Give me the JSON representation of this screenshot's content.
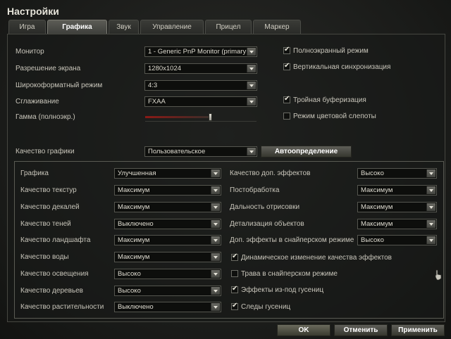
{
  "window": {
    "title": "Настройки"
  },
  "tabs": [
    "Игра",
    "Графика",
    "Звук",
    "Управление",
    "Прицел",
    "Маркер"
  ],
  "active_tab": "Графика",
  "display": {
    "monitor_label": "Монитор",
    "monitor_value": "1 - Generic PnP Monitor (primary",
    "resolution_label": "Разрешение экрана",
    "resolution_value": "1280x1024",
    "widescreen_label": "Широкоформатный режим",
    "widescreen_value": "4:3",
    "aa_label": "Сглаживание",
    "aa_value": "FXAA",
    "gamma_label": "Гамма (полноэкр.)",
    "gamma_level": 0.58
  },
  "checks_right": [
    {
      "label": "Полноэкранный режим",
      "checked": true
    },
    {
      "label": "Вертикальная синхронизация",
      "checked": true
    },
    {
      "label": "Тройная буферизация",
      "checked": true
    },
    {
      "label": "Режим цветовой слепоты",
      "checked": false
    }
  ],
  "quality": {
    "label": "Качество графики",
    "value": "Пользовательское",
    "auto_button": "Автоопределение"
  },
  "left_settings": [
    {
      "label": "Графика",
      "value": "Улучшенная"
    },
    {
      "label": "Качество текстур",
      "value": "Максимум"
    },
    {
      "label": "Качество декалей",
      "value": "Максимум"
    },
    {
      "label": "Качество теней",
      "value": "Выключено"
    },
    {
      "label": "Качество ландшафта",
      "value": "Максимум"
    },
    {
      "label": "Качество воды",
      "value": "Максимум"
    },
    {
      "label": "Качество освещения",
      "value": "Высоко"
    },
    {
      "label": "Качество деревьев",
      "value": "Высоко"
    },
    {
      "label": "Качество растительности",
      "value": "Выключено"
    }
  ],
  "right_settings": [
    {
      "label": "Качество доп. эффектов",
      "value": "Высоко"
    },
    {
      "label": "Постобработка",
      "value": "Максимум"
    },
    {
      "label": "Дальность отрисовки",
      "value": "Максимум"
    },
    {
      "label": "Детализация объектов",
      "value": "Максимум"
    },
    {
      "label": "Доп. эффекты в снайперском режиме",
      "value": "Высоко"
    }
  ],
  "right_checks": [
    {
      "label": "Динамическое изменение качества эффектов",
      "checked": true
    },
    {
      "label": "Трава в снайперском режиме",
      "checked": false
    },
    {
      "label": "Эффекты из-под гусениц",
      "checked": true
    },
    {
      "label": "Следы гусениц",
      "checked": true
    }
  ],
  "buttons": {
    "ok": "OK",
    "cancel": "Отменить",
    "apply": "Применить"
  },
  "colors": {
    "accent_slider": "#8a1a16",
    "background": "#1c1d1b"
  }
}
